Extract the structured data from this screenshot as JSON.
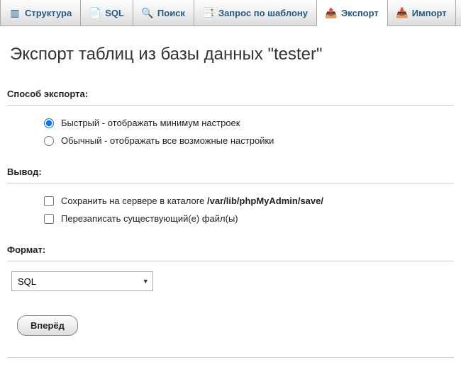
{
  "tabs": [
    {
      "key": "structure",
      "label": "Структура",
      "icon": "structure-icon",
      "glyph": "▥"
    },
    {
      "key": "sql",
      "label": "SQL",
      "icon": "sql-icon",
      "glyph": "📄"
    },
    {
      "key": "search",
      "label": "Поиск",
      "icon": "search-icon",
      "glyph": "🔍"
    },
    {
      "key": "query",
      "label": "Запрос по шаблону",
      "icon": "query-icon",
      "glyph": "📑"
    },
    {
      "key": "export",
      "label": "Экспорт",
      "icon": "export-icon",
      "glyph": "📤",
      "active": true
    },
    {
      "key": "import",
      "label": "Импорт",
      "icon": "import-icon",
      "glyph": "📥"
    }
  ],
  "page_title": "Экспорт таблиц из базы данных \"tester\"",
  "sections": {
    "method": {
      "title": "Способ экспорта:",
      "options": [
        {
          "label": "Быстрый - отображать минимум настроек",
          "checked": true
        },
        {
          "label": "Обычный - отображать все возможные настройки",
          "checked": false
        }
      ]
    },
    "output": {
      "title": "Вывод:",
      "save_label_prefix": "Сохранить на сервере в каталоге ",
      "save_path": "/var/lib/phpMyAdmin/save/",
      "overwrite_label": "Перезаписать существующий(е) файл(ы)"
    },
    "format": {
      "title": "Формат:",
      "selected": "SQL",
      "options": [
        "SQL"
      ]
    }
  },
  "submit_label": "Вперёд"
}
